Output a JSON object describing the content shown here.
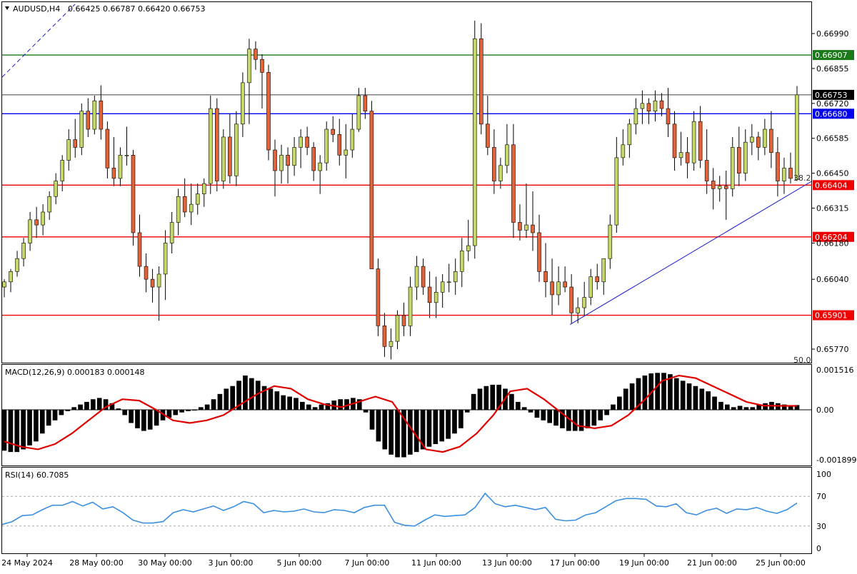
{
  "header": {
    "symbol": "AUDUSD,H4",
    "ohlc": "0.66425 0.66787 0.66420 0.66753"
  },
  "colors": {
    "bull": "#c4d86a",
    "bear": "#e0633a",
    "green_line": "#1a7a1a",
    "blue_line": "#0000ee",
    "red_line": "#ee0000",
    "trend_line": "#1a1acc",
    "macd_signal": "#e00000",
    "rsi_line": "#3b8fe0"
  },
  "price_axis": {
    "ticks": [
      "0.66990",
      "0.66855",
      "0.66720",
      "0.66585",
      "0.66450",
      "0.66315",
      "0.66180",
      "0.66040",
      "0.65770"
    ],
    "tick_values": [
      0.6699,
      0.66855,
      0.6672,
      0.66585,
      0.6645,
      0.66315,
      0.6618,
      0.6604,
      0.6577
    ],
    "current_price_label": "0.66753"
  },
  "levels": [
    {
      "value": 0.66907,
      "label": "0.66907",
      "color": "#1a7a1a"
    },
    {
      "value": 0.6668,
      "label": "0.66680",
      "color": "#0000ee"
    },
    {
      "value": 0.66404,
      "label": "0.66404",
      "color": "#ee0000"
    },
    {
      "value": 0.66204,
      "label": "0.66204",
      "color": "#ee0000"
    },
    {
      "value": 0.65901,
      "label": "0.65901",
      "color": "#ee0000"
    }
  ],
  "fib_labels": {
    "upper": "38.2",
    "lower": "50.0"
  },
  "time_axis": [
    "24 May 2024",
    "28 May 00:00",
    "30 May 00:00",
    "3 Jun 00:00",
    "5 Jun 00:00",
    "7 Jun 00:00",
    "11 Jun 00:00",
    "13 Jun 00:00",
    "17 Jun 00:00",
    "19 Jun 00:00",
    "21 Jun 00:00",
    "25 Jun 00:00"
  ],
  "macd": {
    "title": "MACD(12,26,9) 0.000183 0.000148",
    "ticks": [
      "0.001516",
      "0.00",
      "-0.001899"
    ],
    "tick_values": [
      0.001516,
      0.0,
      -0.001899
    ]
  },
  "rsi": {
    "title": "RSI(14) 60.7085",
    "ticks": [
      "100",
      "70",
      "30",
      "0"
    ],
    "tick_values": [
      100,
      70,
      30,
      0
    ]
  },
  "chart_data": {
    "type": "candlestick",
    "symbol": "AUDUSD",
    "timeframe": "H4",
    "ylim": [
      0.6574,
      0.6707
    ],
    "candles": [
      [
        0.6601,
        0.6604,
        0.6597,
        0.6603
      ],
      [
        0.6603,
        0.6608,
        0.6599,
        0.6607
      ],
      [
        0.6607,
        0.6615,
        0.6605,
        0.6612
      ],
      [
        0.6612,
        0.662,
        0.6609,
        0.6618
      ],
      [
        0.6618,
        0.663,
        0.6615,
        0.6627
      ],
      [
        0.6627,
        0.6632,
        0.662,
        0.6625
      ],
      [
        0.6625,
        0.6633,
        0.6621,
        0.663
      ],
      [
        0.663,
        0.6638,
        0.6627,
        0.6636
      ],
      [
        0.6636,
        0.6645,
        0.6633,
        0.6642
      ],
      [
        0.6642,
        0.6652,
        0.6638,
        0.665
      ],
      [
        0.665,
        0.6662,
        0.6646,
        0.6658
      ],
      [
        0.6658,
        0.6666,
        0.6651,
        0.6655
      ],
      [
        0.6655,
        0.6672,
        0.6652,
        0.6669
      ],
      [
        0.6669,
        0.6674,
        0.6659,
        0.6662
      ],
      [
        0.6662,
        0.6675,
        0.666,
        0.6673
      ],
      [
        0.6673,
        0.6679,
        0.6658,
        0.6662
      ],
      [
        0.6662,
        0.6665,
        0.6643,
        0.6647
      ],
      [
        0.6647,
        0.6659,
        0.664,
        0.6643
      ],
      [
        0.6643,
        0.6655,
        0.664,
        0.6652
      ],
      [
        0.6652,
        0.6663,
        0.6648,
        0.6652
      ],
      [
        0.6652,
        0.6654,
        0.6617,
        0.6622
      ],
      [
        0.6622,
        0.6629,
        0.6605,
        0.6609
      ],
      [
        0.6609,
        0.6614,
        0.6599,
        0.6604
      ],
      [
        0.6604,
        0.6608,
        0.6595,
        0.6601
      ],
      [
        0.6601,
        0.6609,
        0.6588,
        0.6606
      ],
      [
        0.6606,
        0.6623,
        0.6596,
        0.6618
      ],
      [
        0.6618,
        0.663,
        0.6614,
        0.6626
      ],
      [
        0.6626,
        0.6639,
        0.6621,
        0.6636
      ],
      [
        0.6636,
        0.6643,
        0.6628,
        0.663
      ],
      [
        0.663,
        0.6641,
        0.6625,
        0.6633
      ],
      [
        0.6633,
        0.6641,
        0.6629,
        0.6637
      ],
      [
        0.6637,
        0.6643,
        0.6632,
        0.6641
      ],
      [
        0.6641,
        0.6675,
        0.6637,
        0.667
      ],
      [
        0.667,
        0.6674,
        0.6638,
        0.6642
      ],
      [
        0.6642,
        0.6662,
        0.6639,
        0.6659
      ],
      [
        0.6659,
        0.6668,
        0.6641,
        0.6644
      ],
      [
        0.6644,
        0.6669,
        0.664,
        0.6664
      ],
      [
        0.6664,
        0.6684,
        0.6659,
        0.668
      ],
      [
        0.668,
        0.6697,
        0.6664,
        0.6693
      ],
      [
        0.6693,
        0.6696,
        0.6685,
        0.6689
      ],
      [
        0.6689,
        0.6691,
        0.667,
        0.6684
      ],
      [
        0.6684,
        0.6687,
        0.665,
        0.6654
      ],
      [
        0.6654,
        0.6658,
        0.6636,
        0.6646
      ],
      [
        0.6646,
        0.6656,
        0.6641,
        0.6652
      ],
      [
        0.6652,
        0.6655,
        0.6641,
        0.6648
      ],
      [
        0.6648,
        0.6659,
        0.6644,
        0.6655
      ],
      [
        0.6655,
        0.6662,
        0.6647,
        0.6659
      ],
      [
        0.6659,
        0.6663,
        0.6652,
        0.6655
      ],
      [
        0.6655,
        0.6657,
        0.6642,
        0.6646
      ],
      [
        0.6646,
        0.6652,
        0.6637,
        0.6649
      ],
      [
        0.6649,
        0.6665,
        0.6646,
        0.6662
      ],
      [
        0.6662,
        0.6667,
        0.6657,
        0.666
      ],
      [
        0.666,
        0.6666,
        0.6648,
        0.6652
      ],
      [
        0.6652,
        0.6664,
        0.6643,
        0.6654
      ],
      [
        0.6654,
        0.6668,
        0.6651,
        0.6662
      ],
      [
        0.6662,
        0.6678,
        0.6661,
        0.6675
      ],
      [
        0.6675,
        0.6678,
        0.6666,
        0.6669
      ],
      [
        0.6669,
        0.6673,
        0.6613,
        0.6608
      ],
      [
        0.6608,
        0.6612,
        0.6582,
        0.6586
      ],
      [
        0.6586,
        0.6591,
        0.6574,
        0.6578
      ],
      [
        0.6578,
        0.6585,
        0.6573,
        0.658
      ],
      [
        0.658,
        0.6592,
        0.6577,
        0.659
      ],
      [
        0.659,
        0.6595,
        0.6582,
        0.6586
      ],
      [
        0.6586,
        0.6605,
        0.6582,
        0.6601
      ],
      [
        0.6601,
        0.6613,
        0.6596,
        0.6609
      ],
      [
        0.6609,
        0.6612,
        0.6598,
        0.6601
      ],
      [
        0.6601,
        0.6607,
        0.6589,
        0.6595
      ],
      [
        0.6595,
        0.6605,
        0.6589,
        0.6599
      ],
      [
        0.6599,
        0.6606,
        0.6593,
        0.6603
      ],
      [
        0.6603,
        0.661,
        0.6599,
        0.6603
      ],
      [
        0.6603,
        0.6612,
        0.6598,
        0.6607
      ],
      [
        0.6607,
        0.662,
        0.6601,
        0.6615
      ],
      [
        0.6615,
        0.6627,
        0.6611,
        0.6617
      ],
      [
        0.6617,
        0.6704,
        0.6612,
        0.6697
      ],
      [
        0.6697,
        0.6703,
        0.666,
        0.6664
      ],
      [
        0.6664,
        0.6675,
        0.6652,
        0.6655
      ],
      [
        0.6655,
        0.6662,
        0.6637,
        0.6642
      ],
      [
        0.6642,
        0.6651,
        0.6639,
        0.6648
      ],
      [
        0.6648,
        0.6664,
        0.6645,
        0.6656
      ],
      [
        0.6656,
        0.6664,
        0.662,
        0.6626
      ],
      [
        0.6626,
        0.6633,
        0.6619,
        0.6623
      ],
      [
        0.6623,
        0.6641,
        0.662,
        0.6625
      ],
      [
        0.6625,
        0.6638,
        0.6615,
        0.6622
      ],
      [
        0.6622,
        0.6629,
        0.6603,
        0.6607
      ],
      [
        0.6607,
        0.6618,
        0.6597,
        0.6603
      ],
      [
        0.6603,
        0.6612,
        0.659,
        0.6598
      ],
      [
        0.6598,
        0.6609,
        0.6594,
        0.6603
      ],
      [
        0.6603,
        0.6609,
        0.6599,
        0.6601
      ],
      [
        0.6601,
        0.6606,
        0.6587,
        0.6591
      ],
      [
        0.6591,
        0.6597,
        0.6587,
        0.6593
      ],
      [
        0.6593,
        0.6603,
        0.659,
        0.6597
      ],
      [
        0.6597,
        0.6608,
        0.6594,
        0.6605
      ],
      [
        0.6605,
        0.661,
        0.66,
        0.6603
      ],
      [
        0.6603,
        0.6612,
        0.6598,
        0.6612
      ],
      [
        0.6612,
        0.6629,
        0.6608,
        0.6625
      ],
      [
        0.6625,
        0.6659,
        0.6622,
        0.6651
      ],
      [
        0.6651,
        0.6662,
        0.6648,
        0.6656
      ],
      [
        0.6656,
        0.6666,
        0.6651,
        0.6664
      ],
      [
        0.6664,
        0.6674,
        0.666,
        0.667
      ],
      [
        0.667,
        0.6677,
        0.6664,
        0.6672
      ],
      [
        0.6672,
        0.6674,
        0.6664,
        0.6669
      ],
      [
        0.6669,
        0.6677,
        0.6665,
        0.6673
      ],
      [
        0.6673,
        0.6676,
        0.6667,
        0.667
      ],
      [
        0.667,
        0.6678,
        0.6659,
        0.6664
      ],
      [
        0.6664,
        0.6669,
        0.6646,
        0.6651
      ],
      [
        0.6651,
        0.6661,
        0.6648,
        0.6653
      ],
      [
        0.6653,
        0.6659,
        0.6643,
        0.6649
      ],
      [
        0.6649,
        0.6669,
        0.6646,
        0.6665
      ],
      [
        0.6665,
        0.6671,
        0.6647,
        0.665
      ],
      [
        0.665,
        0.6662,
        0.6637,
        0.6642
      ],
      [
        0.6642,
        0.6647,
        0.6631,
        0.6639
      ],
      [
        0.6639,
        0.6644,
        0.6634,
        0.664
      ],
      [
        0.664,
        0.6646,
        0.6627,
        0.6639
      ],
      [
        0.6639,
        0.6659,
        0.6636,
        0.6655
      ],
      [
        0.6655,
        0.6663,
        0.664,
        0.6645
      ],
      [
        0.6645,
        0.6662,
        0.6642,
        0.6657
      ],
      [
        0.6657,
        0.6664,
        0.6652,
        0.6659
      ],
      [
        0.6659,
        0.6661,
        0.665,
        0.6655
      ],
      [
        0.6655,
        0.6666,
        0.6652,
        0.6662
      ],
      [
        0.6662,
        0.6669,
        0.6647,
        0.6653
      ],
      [
        0.6653,
        0.6659,
        0.6636,
        0.6642
      ],
      [
        0.6642,
        0.6651,
        0.6637,
        0.6647
      ],
      [
        0.6647,
        0.6653,
        0.6641,
        0.6643
      ],
      [
        0.66425,
        0.66787,
        0.6642,
        0.66753
      ]
    ],
    "trendline": {
      "from_price": 0.65865,
      "to_price": 0.66418
    },
    "macd_histogram": [
      -0.00155,
      -0.0016,
      -0.0016,
      -0.0015,
      -0.00135,
      -0.0012,
      -0.0009,
      -0.0006,
      -0.0004,
      -0.0002,
      -5e-05,
      0.0001,
      0.0002,
      0.0003,
      0.0004,
      0.00045,
      0.0004,
      0.00025,
      5e-05,
      -0.0002,
      -0.0005,
      -0.0007,
      -0.0008,
      -0.00075,
      -0.0006,
      -0.0004,
      -0.0003,
      -0.0002,
      -0.0001,
      -5e-05,
      0.0,
      0.0001,
      0.0002,
      0.0004,
      0.0006,
      0.0008,
      0.0009,
      0.0011,
      0.0013,
      0.0012,
      0.0011,
      0.0009,
      0.0008,
      0.0007,
      0.00055,
      0.0005,
      0.00045,
      0.0003,
      0.0002,
      0.0001,
      0.0002,
      0.00025,
      0.00035,
      0.0004,
      0.0004,
      0.00045,
      0.0004,
      -0.0001,
      -0.00075,
      -0.0012,
      -0.0015,
      -0.0017,
      -0.0018,
      -0.0018,
      -0.0017,
      -0.0016,
      -0.0015,
      -0.0014,
      -0.0013,
      -0.0012,
      -0.0011,
      -0.0009,
      -0.0007,
      -0.0001,
      0.0006,
      0.0008,
      0.0009,
      0.00095,
      0.00095,
      0.0008,
      0.0006,
      0.0003,
      0.0001,
      -0.0001,
      -0.0003,
      -0.0004,
      -0.0005,
      -0.0006,
      -0.0007,
      -0.0008,
      -0.0008,
      -0.0008,
      -0.0007,
      -0.0006,
      -0.0004,
      -0.0002,
      0.0002,
      0.0005,
      0.0008,
      0.001,
      0.0012,
      0.0013,
      0.00138,
      0.0014,
      0.0014,
      0.00135,
      0.0012,
      0.0011,
      0.001,
      0.0009,
      0.0008,
      0.0007,
      0.0005,
      0.0003,
      0.0002,
      0.0001,
      0.00015,
      0.0001,
      0.0001,
      0.0002,
      0.00025,
      0.0003,
      0.00025,
      0.0002,
      0.00015,
      0.00018
    ],
    "macd_signal": [
      -0.0012,
      -0.0014,
      -0.0015,
      -0.0013,
      -0.0009,
      -0.0004,
      0.0001,
      0.0004,
      0.00035,
      0.0,
      -0.0004,
      -0.0005,
      -0.0004,
      -0.0002,
      0.0002,
      0.0006,
      0.0009,
      0.0008,
      0.0004,
      0.0002,
      0.0001,
      0.0003,
      0.0005,
      0.0003,
      -0.0006,
      -0.0015,
      -0.0016,
      -0.0014,
      -0.0009,
      -0.0002,
      0.0007,
      0.0008,
      0.0004,
      -0.0001,
      -0.0006,
      -0.0007,
      -0.0006,
      -0.0002,
      0.0004,
      0.0011,
      0.0013,
      0.0012,
      0.0009,
      0.0006,
      0.0003,
      0.00016,
      0.00015,
      0.00015
    ],
    "rsi_values": [
      32,
      36,
      44,
      45,
      52,
      58,
      58,
      63,
      57,
      62,
      53,
      56,
      48,
      38,
      34,
      34,
      36,
      48,
      52,
      49,
      53,
      57,
      51,
      56,
      63,
      60,
      48,
      51,
      49,
      50,
      53,
      49,
      48,
      52,
      51,
      48,
      55,
      58,
      58,
      35,
      31,
      30,
      38,
      45,
      43,
      44,
      45,
      55,
      74,
      60,
      56,
      58,
      55,
      52,
      55,
      39,
      37,
      38,
      45,
      48,
      56,
      64,
      67,
      67,
      66,
      57,
      56,
      60,
      48,
      45,
      51,
      54,
      47,
      53,
      52,
      55,
      50,
      47,
      52,
      61
    ]
  }
}
